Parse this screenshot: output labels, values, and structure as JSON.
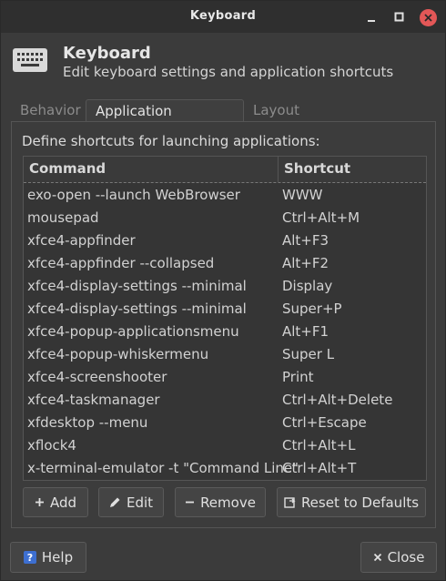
{
  "window": {
    "title": "Keyboard"
  },
  "header": {
    "title": "Keyboard",
    "subtitle": "Edit keyboard settings and application shortcuts"
  },
  "tabs": [
    {
      "label": "Behavior",
      "active": false
    },
    {
      "label": "Application Shortcuts",
      "active": true
    },
    {
      "label": "Layout",
      "active": false
    }
  ],
  "panel": {
    "description": "Define shortcuts for launching applications:",
    "columns": {
      "command": "Command",
      "shortcut": "Shortcut"
    },
    "rows": [
      {
        "command": "exo-open --launch WebBrowser",
        "shortcut": "WWW"
      },
      {
        "command": "mousepad",
        "shortcut": "Ctrl+Alt+M"
      },
      {
        "command": "xfce4-appfinder",
        "shortcut": "Alt+F3"
      },
      {
        "command": "xfce4-appfinder --collapsed",
        "shortcut": "Alt+F2"
      },
      {
        "command": "xfce4-display-settings --minimal",
        "shortcut": "Display"
      },
      {
        "command": "xfce4-display-settings --minimal",
        "shortcut": "Super+P"
      },
      {
        "command": "xfce4-popup-applicationsmenu",
        "shortcut": "Alt+F1"
      },
      {
        "command": "xfce4-popup-whiskermenu",
        "shortcut": "Super L"
      },
      {
        "command": "xfce4-screenshooter",
        "shortcut": "Print"
      },
      {
        "command": "xfce4-taskmanager",
        "shortcut": "Ctrl+Alt+Delete"
      },
      {
        "command": "xfdesktop --menu",
        "shortcut": "Ctrl+Escape"
      },
      {
        "command": "xflock4",
        "shortcut": "Ctrl+Alt+L"
      },
      {
        "command": "x-terminal-emulator -t \"Command Line\"",
        "shortcut": "Ctrl+Alt+T"
      }
    ]
  },
  "buttons": {
    "add": "Add",
    "edit": "Edit",
    "remove": "Remove",
    "reset": "Reset to Defaults",
    "help": "Help",
    "close": "Close"
  },
  "colors": {
    "close_button": "#e35757",
    "help_icon": "#3d6fd1"
  }
}
